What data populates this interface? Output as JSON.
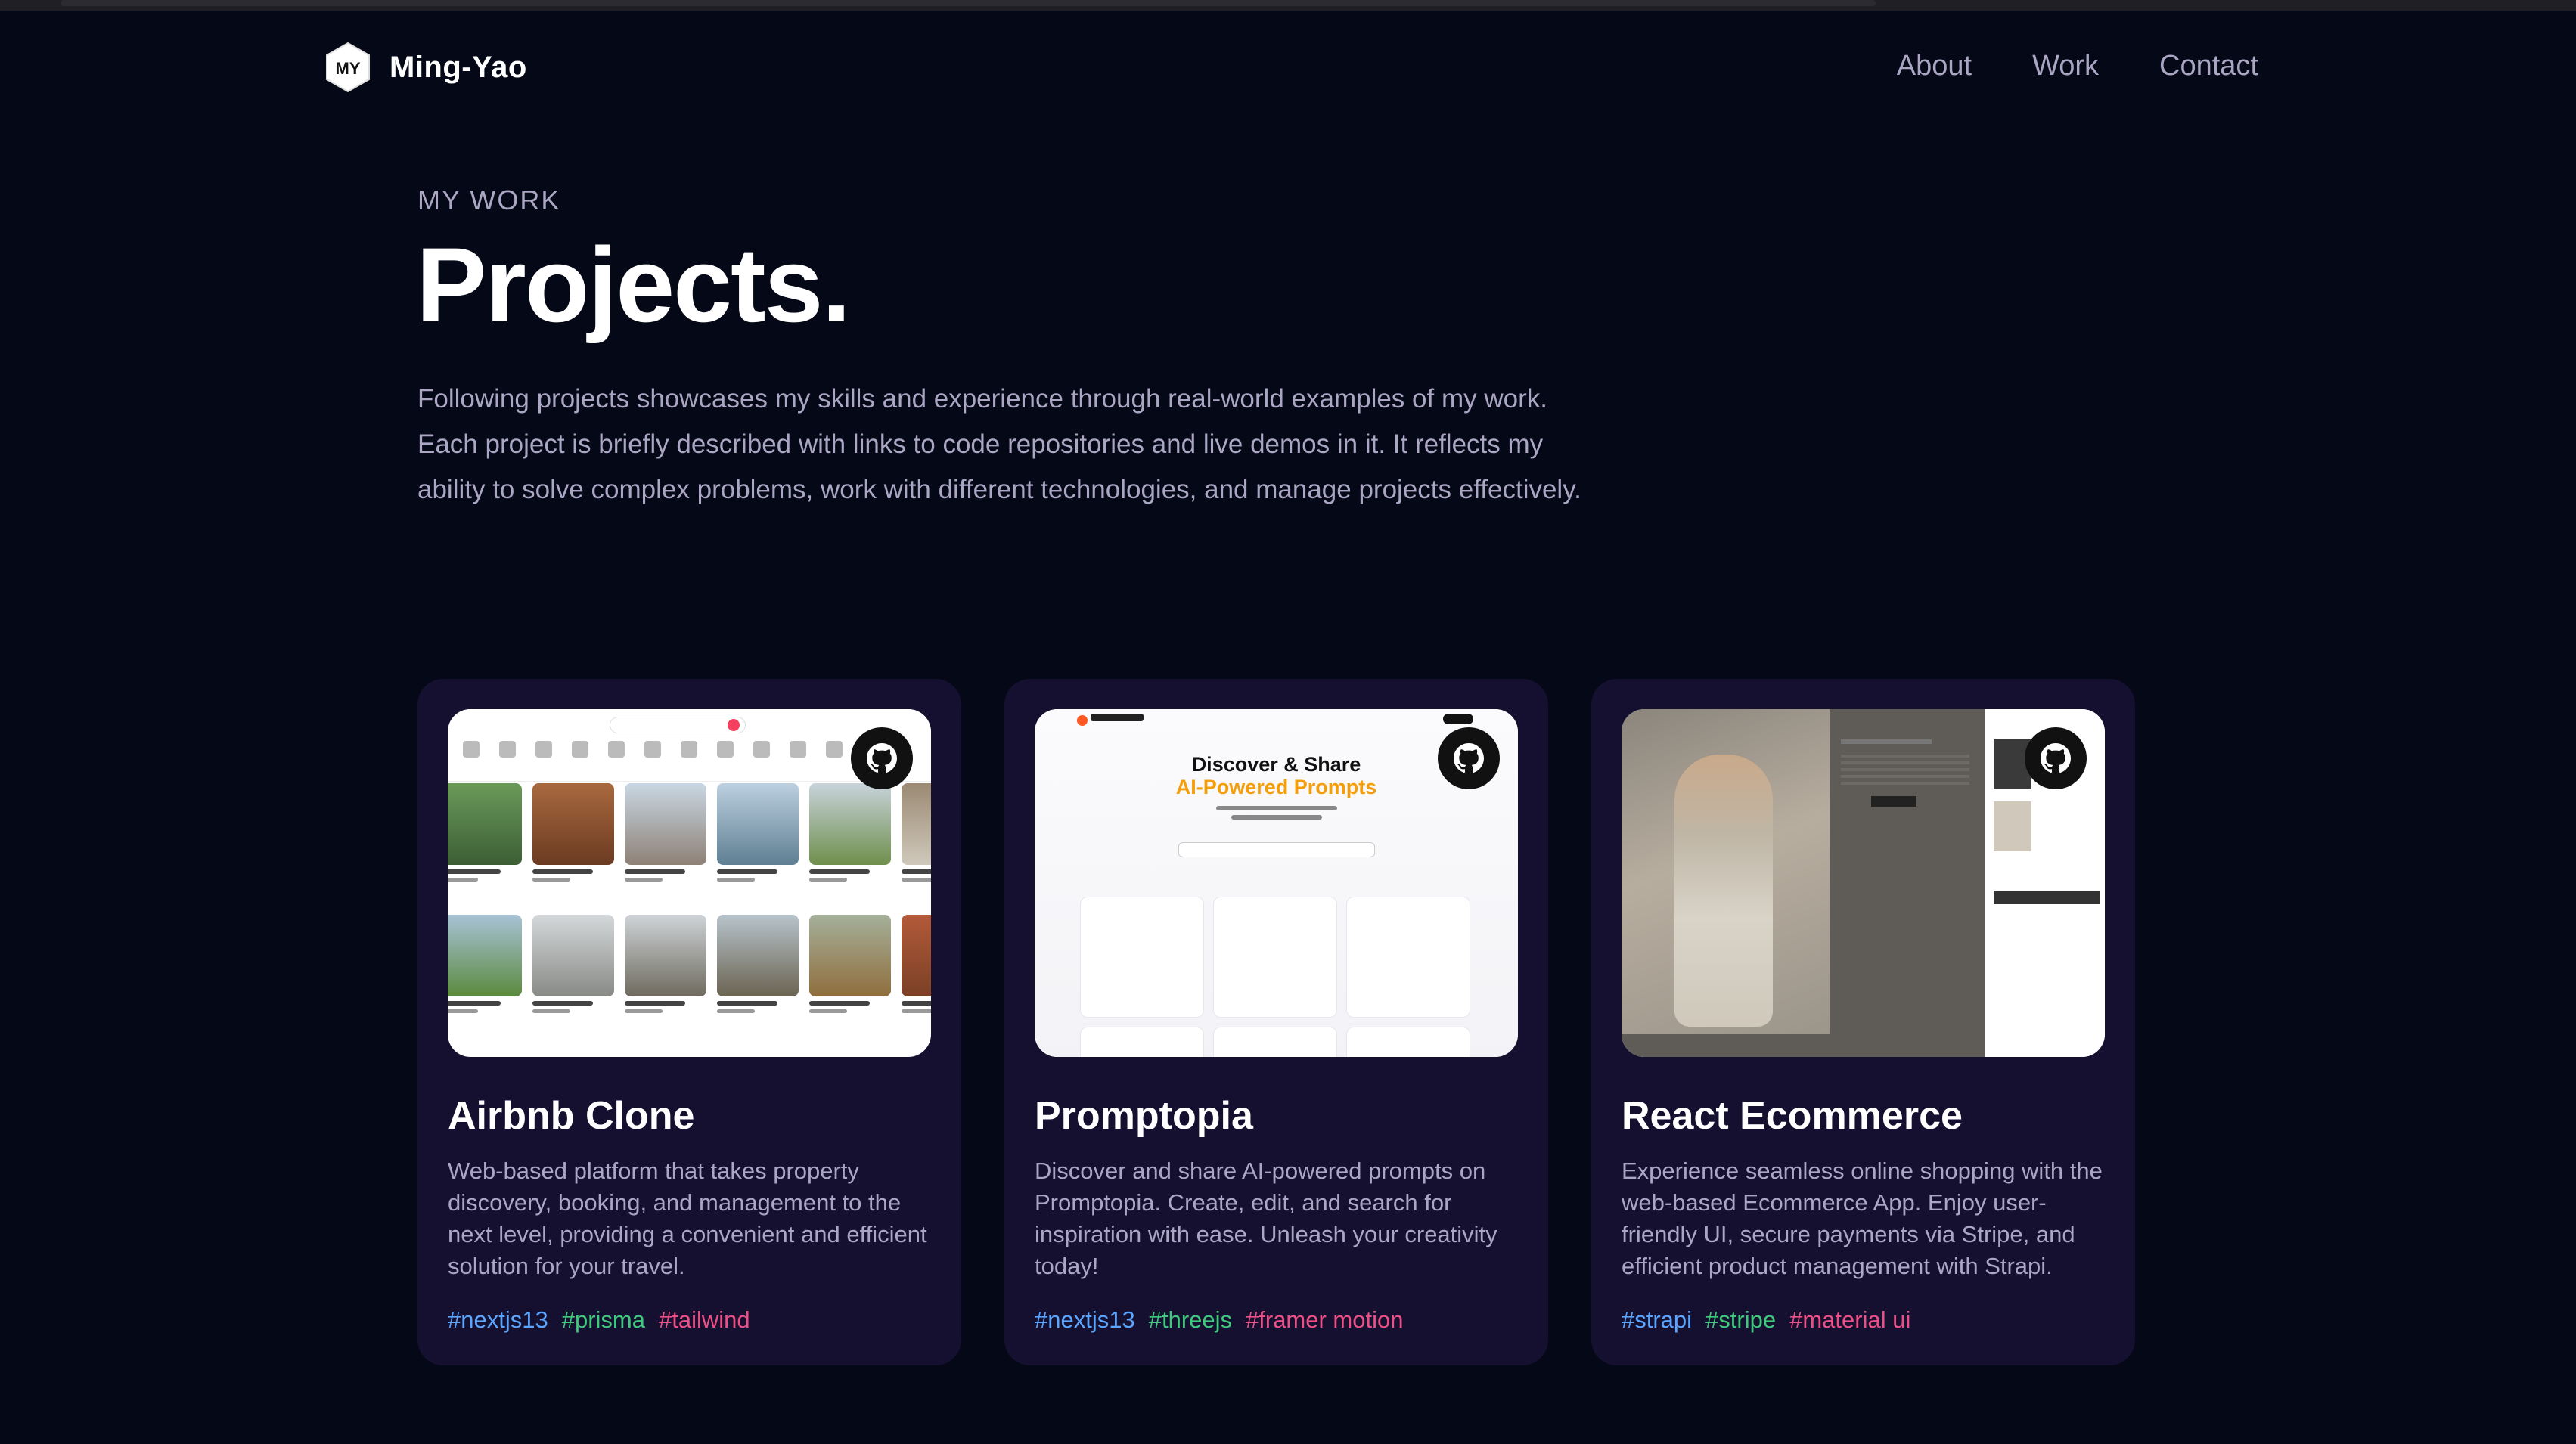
{
  "brand": {
    "logo_text": "MY",
    "name": "Ming-Yao"
  },
  "nav": {
    "links": [
      "About",
      "Work",
      "Contact"
    ]
  },
  "hero": {
    "subtitle": "MY WORK",
    "title": "Projects.",
    "description": "Following projects showcases my skills and experience through real-world examples of my work. Each project is briefly described with links to code repositories and live demos in it. It reflects my ability to solve complex problems, work with different technologies, and manage projects effectively."
  },
  "projects": [
    {
      "title": "Airbnb Clone",
      "description": "Web-based platform that takes property discovery, booking, and management to the next level, providing a convenient and efficient solution for your travel.",
      "tags": [
        {
          "name": "#nextjs13",
          "color": "#5aa5ff"
        },
        {
          "name": "#prisma",
          "color": "#3ec97d"
        },
        {
          "name": "#tailwind",
          "color": "#ec4f86"
        }
      ]
    },
    {
      "title": "Promptopia",
      "description": "Discover and share AI-powered prompts on Promptopia. Create, edit, and search for inspiration with ease. Unleash your creativity today!",
      "thumb_heading_1": "Discover & Share",
      "thumb_heading_2": "AI-Powered Prompts",
      "tags": [
        {
          "name": "#nextjs13",
          "color": "#5aa5ff"
        },
        {
          "name": "#threejs",
          "color": "#3ec97d"
        },
        {
          "name": "#framer motion",
          "color": "#ec4f86"
        }
      ]
    },
    {
      "title": "React Ecommerce",
      "description": "Experience seamless online shopping with the web-based Ecommerce App. Enjoy user-friendly UI, secure payments via Stripe, and efficient product management with Strapi.",
      "tags": [
        {
          "name": "#strapi",
          "color": "#5aa5ff"
        },
        {
          "name": "#stripe",
          "color": "#3ec97d"
        },
        {
          "name": "#material ui",
          "color": "#ec4f86"
        }
      ]
    }
  ],
  "colors": {
    "background": "#050816",
    "card": "#151030",
    "secondary_text": "#aaa6c3"
  },
  "icons": {
    "repo": "github-icon"
  }
}
